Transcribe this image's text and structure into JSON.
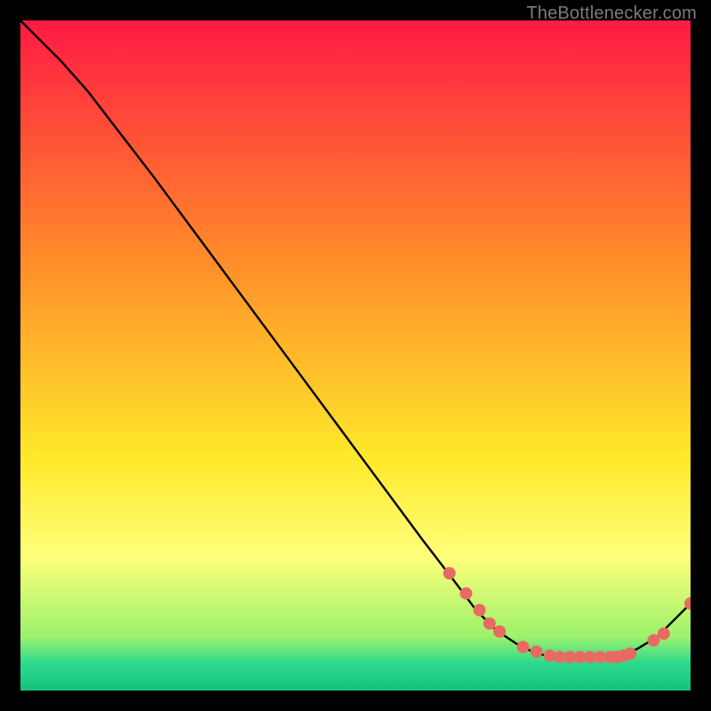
{
  "attribution": "TheBottlenecker.com",
  "colors": {
    "top_gradient": "#ff1a44",
    "mid1_gradient": "#ff8a2a",
    "mid2_gradient": "#ffe82a",
    "low_gradient": "#ffff7a",
    "green1": "#9bf26c",
    "green2": "#2bd98e",
    "green3": "#16c27b",
    "curve": "#000000",
    "marker": "#e86b63"
  },
  "chart_data": {
    "type": "line",
    "title": "",
    "xlabel": "",
    "ylabel": "",
    "xlim": [
      0,
      100
    ],
    "ylim": [
      0,
      100
    ],
    "grid": false,
    "legend": false,
    "series": [
      {
        "name": "bottleneck-curve",
        "x": [
          0,
          6,
          10,
          20,
          30,
          40,
          50,
          60,
          65,
          68,
          71,
          74,
          77,
          80,
          83,
          86,
          89,
          92,
          95,
          98,
          100
        ],
        "y": [
          100,
          94,
          89.5,
          76.5,
          63,
          49.5,
          36,
          22.5,
          16,
          12,
          9,
          7,
          5.5,
          5,
          5,
          5,
          5,
          6.2,
          8,
          11,
          13
        ]
      }
    ],
    "markers": {
      "name": "highlight-points",
      "x": [
        64,
        66.5,
        68.5,
        70,
        71.5,
        75,
        77,
        79,
        80.5,
        82,
        83.5,
        85,
        86.5,
        88,
        89,
        90,
        91,
        94.5,
        96,
        100
      ],
      "y": [
        17.5,
        14.5,
        12,
        10,
        8.8,
        6.5,
        5.8,
        5.2,
        5,
        5,
        5,
        5,
        5,
        5,
        5,
        5.2,
        5.5,
        7.5,
        8.5,
        13
      ]
    }
  }
}
